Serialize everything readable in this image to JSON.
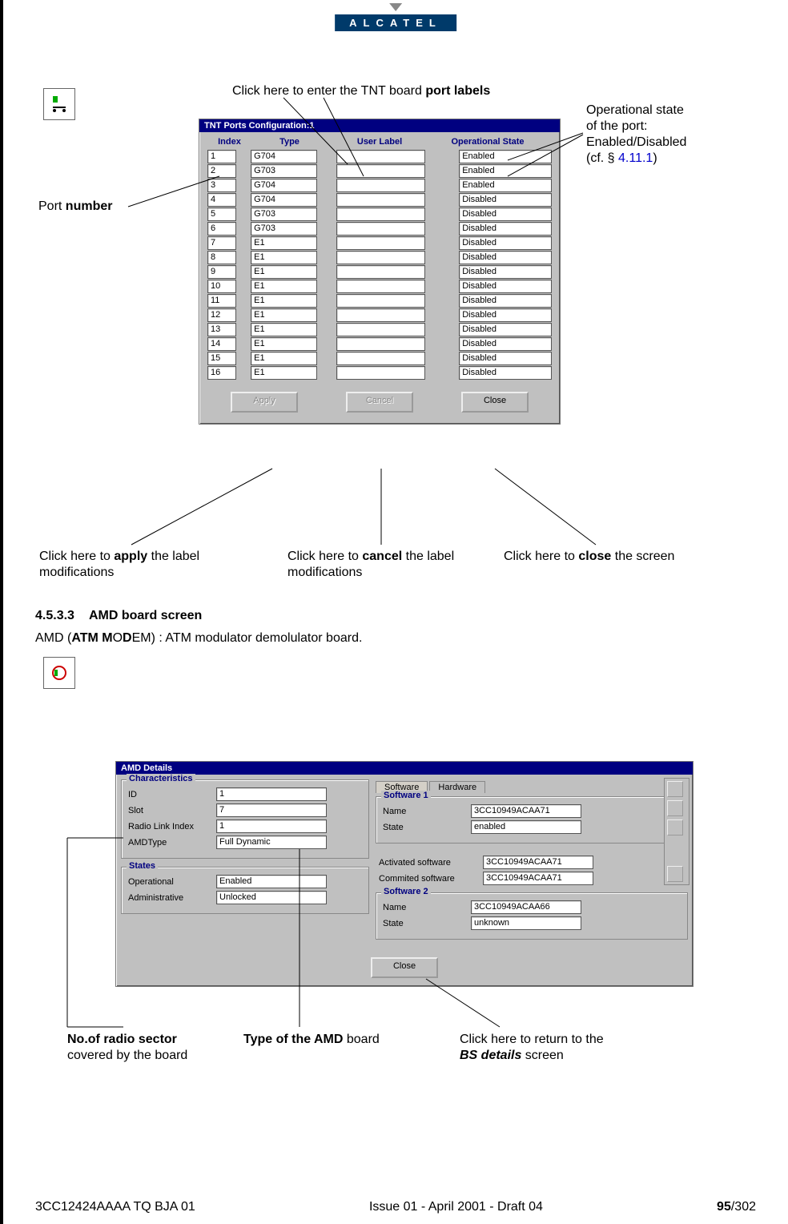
{
  "header_brand": "ALCATEL",
  "tnt": {
    "title": "TNT Ports Configuration:1",
    "columns": {
      "index": "Index",
      "type": "Type",
      "user": "User Label",
      "state": "Operational State"
    },
    "rows": [
      {
        "index": "1",
        "type": "G704",
        "user": "",
        "state": "Enabled"
      },
      {
        "index": "2",
        "type": "G703",
        "user": "",
        "state": "Enabled"
      },
      {
        "index": "3",
        "type": "G704",
        "user": "",
        "state": "Enabled"
      },
      {
        "index": "4",
        "type": "G704",
        "user": "",
        "state": "Disabled"
      },
      {
        "index": "5",
        "type": "G703",
        "user": "",
        "state": "Disabled"
      },
      {
        "index": "6",
        "type": "G703",
        "user": "",
        "state": "Disabled"
      },
      {
        "index": "7",
        "type": "E1",
        "user": "",
        "state": "Disabled"
      },
      {
        "index": "8",
        "type": "E1",
        "user": "",
        "state": "Disabled"
      },
      {
        "index": "9",
        "type": "E1",
        "user": "",
        "state": "Disabled"
      },
      {
        "index": "10",
        "type": "E1",
        "user": "",
        "state": "Disabled"
      },
      {
        "index": "11",
        "type": "E1",
        "user": "",
        "state": "Disabled"
      },
      {
        "index": "12",
        "type": "E1",
        "user": "",
        "state": "Disabled"
      },
      {
        "index": "13",
        "type": "E1",
        "user": "",
        "state": "Disabled"
      },
      {
        "index": "14",
        "type": "E1",
        "user": "",
        "state": "Disabled"
      },
      {
        "index": "15",
        "type": "E1",
        "user": "",
        "state": "Disabled"
      },
      {
        "index": "16",
        "type": "E1",
        "user": "",
        "state": "Disabled"
      }
    ],
    "buttons": {
      "apply": "Apply",
      "cancel": "Cancel",
      "close": "Close"
    }
  },
  "callouts": {
    "port_labels_pre": "Click here to enter the TNT board ",
    "port_labels_bold": "port labels",
    "port_number_pre": "Port ",
    "port_number_bold": "number",
    "op_state_l1": "Operational state",
    "op_state_l2": "of the port:",
    "op_state_l3": "Enabled/Disabled",
    "op_state_l4_pre": "(cf. § ",
    "op_state_l4_link": "4.11.1",
    "op_state_l4_post": ")",
    "apply_pre": "Click here to ",
    "apply_bold": "apply",
    "apply_post": " the label",
    "apply_l2": "modifications",
    "cancel_pre": "Click here to ",
    "cancel_bold": "cancel",
    "cancel_post": " the label",
    "cancel_l2": "modifications",
    "close_pre": "Click here to ",
    "close_bold": "close",
    "close_post": " the screen",
    "radio_l1_bold": "No.of radio sector",
    "radio_l2": "covered by the board",
    "amdtype_bold": "Type of the AMD",
    "amdtype_post": " board",
    "bs_l1": "Click here to return to the",
    "bs_l2_bold": "BS details",
    "bs_l2_post": " screen"
  },
  "section": {
    "num": "4.5.3.3",
    "title": "AMD board screen"
  },
  "body_line_pre": "AMD (",
  "body_line_bold": "ATM M",
  "body_line_mid": "O",
  "body_line_bold2": "D",
  "body_line_post": "EM) : ATM modulator demolulator board.",
  "amd": {
    "title": "AMD Details",
    "groups": {
      "char": "Characteristics",
      "states": "States",
      "sw1": "Software 1",
      "sw2": "Software 2"
    },
    "char": {
      "id_k": "ID",
      "id_v": "1",
      "slot_k": "Slot",
      "slot_v": "7",
      "rli_k": "Radio Link Index",
      "rli_v": "1",
      "type_k": "AMDType",
      "type_v": "Full Dynamic"
    },
    "states": {
      "op_k": "Operational",
      "op_v": "Enabled",
      "adm_k": "Administrative",
      "adm_v": "Unlocked"
    },
    "tabs": {
      "sw": "Software",
      "hw": "Hardware"
    },
    "sw1": {
      "name_k": "Name",
      "name_v": "3CC10949ACAA71",
      "state_k": "State",
      "state_v": "enabled"
    },
    "mid": {
      "act_k": "Activated software",
      "act_v": "3CC10949ACAA71",
      "com_k": "Commited software",
      "com_v": "3CC10949ACAA71"
    },
    "sw2": {
      "name_k": "Name",
      "name_v": "3CC10949ACAA66",
      "state_k": "State",
      "state_v": "unknown"
    },
    "close": "Close"
  },
  "footer": {
    "left": "3CC12424AAAA TQ BJA 01",
    "center": "Issue 01 - April 2001 - Draft 04",
    "right_bold": "95",
    "right_post": "/302"
  }
}
